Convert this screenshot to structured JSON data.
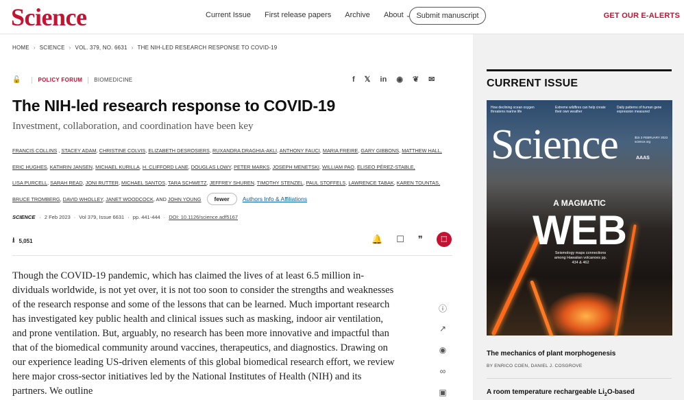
{
  "header": {
    "logo": "Science",
    "nav": [
      "Current Issue",
      "First release papers",
      "Archive",
      "About"
    ],
    "submit": "Submit manuscript",
    "ealerts": "GET OUR E-ALERTS"
  },
  "breadcrumb": [
    "HOME",
    "SCIENCE",
    "VOL. 379, NO. 6631",
    "THE NIH-LED RESEARCH RESPONSE TO COVID-19"
  ],
  "article": {
    "section": "POLICY FORUM",
    "topic": "BIOMEDICINE",
    "title": "The NIH-led research response to COVID-19",
    "subtitle": "Investment, collaboration, and coordination have been key",
    "authors_line1": [
      "FRANCIS COLLINS",
      "STACEY ADAM",
      "CHRISTINE COLVIS",
      "ELIZABETH DESROSIERS",
      "RUXANDRA DRAGHIA-AKLI",
      "ANTHONY FAUCI",
      "MARIA FREIRE",
      "GARY GIBBONS",
      "MATTHEW HALL,"
    ],
    "authors_line2": [
      "ERIC HUGHES",
      "KATHRIN JANSEN",
      "MICHAEL KURILLA",
      "H. CLIFFORD LANE",
      "DOUGLAS LOWY",
      "PETER MARKS",
      "JOSEPH MENETSKI",
      "WILLIAM PAO",
      "ELISEO PÉREZ-STABLE,"
    ],
    "authors_line3": [
      "LISA PURCELL",
      "SARAH READ",
      "JONI RUTTER",
      "MICHAEL SANTOS",
      "TARA SCHWETZ",
      "JEFFREY SHUREN",
      "TIMOTHY STENZEL",
      "PAUL STOFFELS",
      "LAWRENCE TABAK",
      "KAREN TOUNTAS,"
    ],
    "authors_line4": [
      "BRUCE TROMBERG",
      "DAVID WHOLLEY",
      "JANET WOODCOCK"
    ],
    "authors_and": "AND",
    "authors_last": "JOHN YOUNG",
    "fewer": "fewer",
    "affiliations": "Authors Info & Affiliations",
    "journal": "SCIENCE",
    "date": "2 Feb 2023",
    "volume": "Vol 379, Issue 6631",
    "pages": "pp. 441-444",
    "doi": "DOI: 10.1126/science.adf5167",
    "downloads": "5,051",
    "body": "Though the COVID-19 pandemic, which has claimed the lives of at least 6.5 million in-dividuals worldwide, is not yet over, it is not too soon to consider the strengths and weaknesses of the research response and some of the lessons that can be learned. Much important research has investigated key public health and clinical issues such as masking, indoor air ventilation, and prone ventilation. But, arguably, no research has been more innovative and impactful than that of the biomedical community around vaccines, therapeutics, and diagnostics. Drawing on our experience leading US-driven elements of this global biomedical research effort, we review here major cross-sector initiatives led by the National Institutes of Health (NIH) and its partners. We outline"
  },
  "sidebar": {
    "heading": "CURRENT ISSUE",
    "cover": {
      "teaser1": "How declining ocean oxygen threatens marine life",
      "teaser2": "Extreme wildfires can help create their own weather",
      "teaser3": "Daily patterns of human gene expression measured",
      "logo": "Science",
      "date": "$15 3 FEBRUARY 2023 science.org",
      "aaas": "AAAS",
      "headline1": "A MAGMATIC",
      "headline2": "WEB",
      "tagline": "Seismology maps connections among Hawaiian volcanoes pp. 434 & 462"
    },
    "item1_title": "The mechanics of plant morphogenesis",
    "item1_by": "BY ENRICO COEN, DANIEL J. COSGROVE",
    "item2_title_pre": "A room temperature rechargeable Li",
    "item2_sub": "2",
    "item2_title_post": "O-based"
  }
}
